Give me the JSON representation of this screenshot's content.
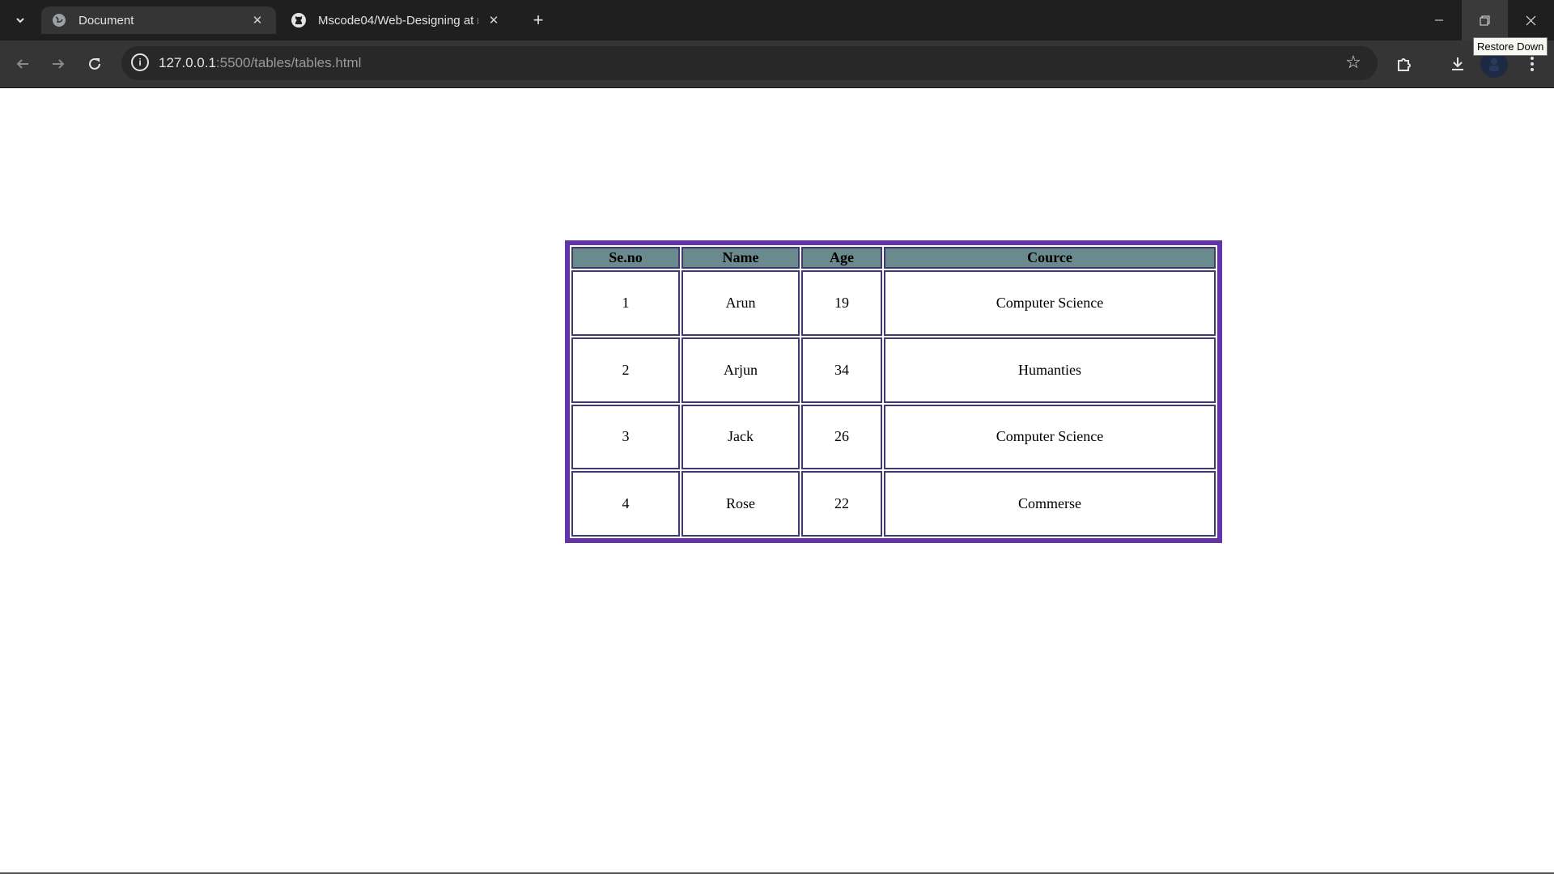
{
  "browser": {
    "tabs": [
      {
        "title": "Document",
        "active": true
      },
      {
        "title": "Mscode04/Web-Designing at m",
        "active": false
      }
    ],
    "url_host": "127.0.0.1",
    "url_path": ":5500/tables/tables.html",
    "tooltip": "Restore Down",
    "icons": {
      "tab_menu": "chevron-down-icon",
      "tab1_favicon": "globe-icon",
      "tab2_favicon": "github-icon",
      "new_tab": "plus-icon",
      "back": "arrow-left-icon",
      "forward": "arrow-right-icon",
      "reload": "reload-icon",
      "site_info": "info-icon",
      "bookmark": "star-icon",
      "extensions": "puzzle-icon",
      "downloads": "download-icon",
      "profile": "avatar-icon",
      "menu": "kebab-menu-icon"
    }
  },
  "table": {
    "headers": [
      "Se.no",
      "Name",
      "Age",
      "Cource"
    ],
    "rows": [
      [
        "1",
        "Arun",
        "19",
        "Computer Science"
      ],
      [
        "2",
        "Arjun",
        "34",
        "Humanties"
      ],
      [
        "3",
        "Jack",
        "26",
        "Computer Science"
      ],
      [
        "4",
        "Rose",
        "22",
        "Commerse"
      ]
    ],
    "colors": {
      "border": "#6435a6",
      "header_bg": "#6b8a8d",
      "cell_border": "#3e3a6e"
    }
  }
}
